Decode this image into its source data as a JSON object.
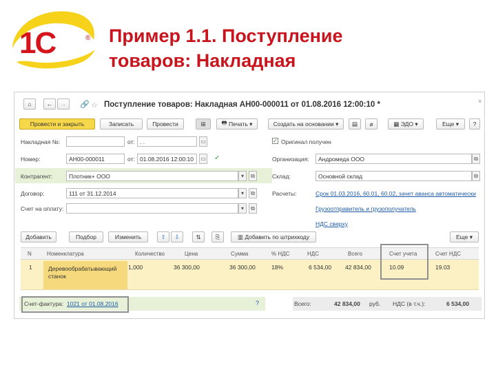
{
  "slide": {
    "title_line1": "Пример 1.1. Поступление",
    "title_line2": "товаров: Накладная",
    "logo_text": "1С",
    "logo_reg": "®"
  },
  "window": {
    "title": "Поступление товаров: Накладная АН00-000011 от 01.08.2016 12:00:10 *",
    "nav": {
      "home": "⌂",
      "back": "←",
      "forward": "→",
      "star": "☆",
      "link": "🔗",
      "close": "×"
    },
    "toolbar": {
      "post_close": "Провести и закрыть",
      "save": "Записать",
      "post": "Провести",
      "print": "Печать",
      "create_based": "Создать на основании",
      "edo": "ЭДО",
      "more": "Еще",
      "help": "?"
    }
  },
  "form": {
    "invoice_no_label": "Накладная №:",
    "invoice_no_value": "",
    "invoice_from_label": "от:",
    "invoice_from_value": ". .",
    "original_label": "Оригинал получен",
    "number_label": "Номер:",
    "number_value": "АН00-000011",
    "date_from_label": "от:",
    "date_value": "01.08.2016 12:00:10",
    "org_label": "Организация:",
    "org_value": "Андромеда ООО",
    "counterparty_label": "Контрагент:",
    "counterparty_value": "Плотник+ ООО",
    "warehouse_label": "Склад:",
    "warehouse_value": "Основной склад",
    "contract_label": "Договор:",
    "contract_value": "111 от 31.12.2014",
    "settlements_label": "Расчеты:",
    "settlements_value": "Срок 01.03.2016, 60.01, 60.02, зачет аванса автоматически",
    "pay_invoice_label": "Счет на оплату:",
    "shipper_link": "Грузоотправитель и грузополучатель",
    "vat_link": "НДС сверху"
  },
  "table_toolbar": {
    "add": "Добавить",
    "select": "Подбор",
    "change": "Изменить",
    "barcode": "Добавить по штрихкоду",
    "more": "Еще"
  },
  "table": {
    "columns": [
      "N",
      "Номенклатура",
      "Количество",
      "Цена",
      "Сумма",
      "% НДС",
      "НДС",
      "Всего",
      "Счет учета",
      "Счет НДС"
    ],
    "rows": [
      [
        "1",
        "Деревообрабатывающий станок",
        "1,000",
        "36 300,00",
        "36 300,00",
        "18%",
        "6 534,00",
        "42 834,00",
        "10.09",
        "19.03"
      ]
    ]
  },
  "footer": {
    "invoice_label": "Счет-фактура:",
    "invoice_link": "1021 от 01.08.2016",
    "help": "?",
    "total_label": "Всего:",
    "total_value": "42 834,00",
    "currency": "руб.",
    "vat_label": "НДС (в т.ч.):",
    "vat_value": "6 534,00"
  }
}
